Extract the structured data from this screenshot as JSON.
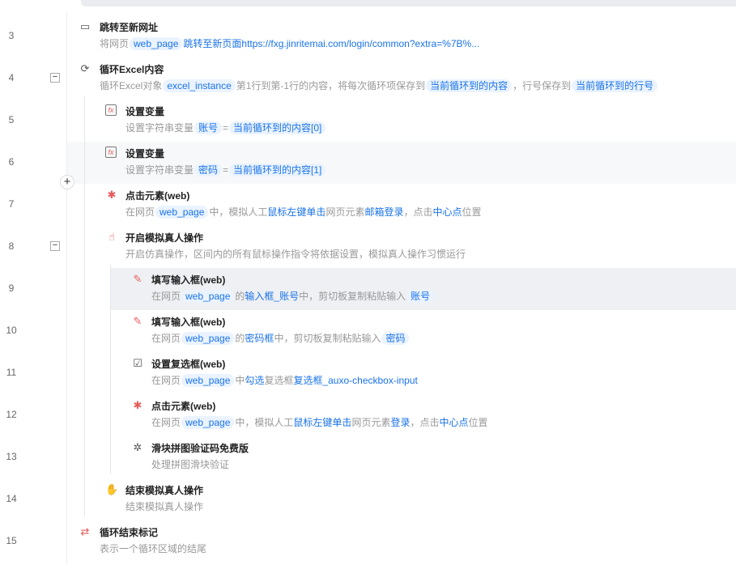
{
  "rows": [
    {
      "num": "3",
      "level": 0,
      "icon": "browser-redirect-icon",
      "glyph": "▭",
      "title": "跳转至新网址",
      "desc": [
        {
          "t": "将网页",
          "k": "g"
        },
        {
          "t": "web_page",
          "k": "chip"
        },
        {
          "t": "跳转至新页面https://fxg.jinritemai.com/login/common?extra=%7B%...",
          "k": "b"
        }
      ]
    },
    {
      "num": "4",
      "level": 0,
      "toggle": "−",
      "icon": "excel-loop-icon",
      "glyph": "⟳",
      "title": "循环Excel内容",
      "desc": [
        {
          "t": "循环Excel对象",
          "k": "g"
        },
        {
          "t": "excel_instance",
          "k": "chip"
        },
        {
          "t": "第1行到第-1行的内容，将每次循环项保存到",
          "k": "g"
        },
        {
          "t": "当前循环到的内容",
          "k": "chip"
        },
        {
          "t": "，行号保存到",
          "k": "g"
        },
        {
          "t": "当前循环到的行号",
          "k": "chip"
        }
      ]
    },
    {
      "num": "5",
      "level": 1,
      "icon": "set-variable-icon",
      "glyph": "fx",
      "title": "设置变量",
      "desc": [
        {
          "t": "设置字符串变量",
          "k": "g"
        },
        {
          "t": "账号",
          "k": "chip"
        },
        {
          "t": "=",
          "k": "g"
        },
        {
          "t": "当前循环到的内容[0]",
          "k": "chip"
        }
      ]
    },
    {
      "num": "6",
      "level": 1,
      "hl": "light",
      "icon": "set-variable-icon",
      "glyph": "fx",
      "title": "设置变量",
      "desc": [
        {
          "t": "设置字符串变量",
          "k": "g"
        },
        {
          "t": "密码",
          "k": "chip"
        },
        {
          "t": "=",
          "k": "g"
        },
        {
          "t": "当前循环到的内容[1]",
          "k": "chip"
        }
      ]
    },
    {
      "num": "7",
      "level": 1,
      "icon": "click-element-icon",
      "glyph": "✱",
      "title": "点击元素(web)",
      "desc": [
        {
          "t": "在网页",
          "k": "g"
        },
        {
          "t": "web_page",
          "k": "chip"
        },
        {
          "t": "中，模拟人工",
          "k": "g"
        },
        {
          "t": "鼠标左键单击",
          "k": "b"
        },
        {
          "t": "网页元素",
          "k": "g"
        },
        {
          "t": "邮箱登录",
          "k": "b"
        },
        {
          "t": "，点击",
          "k": "g"
        },
        {
          "t": "中心点",
          "k": "b"
        },
        {
          "t": "位置",
          "k": "g"
        }
      ]
    },
    {
      "num": "8",
      "level": 1,
      "toggle": "−",
      "icon": "hand-pointer-icon",
      "glyph": "☝",
      "title": "开启模拟真人操作",
      "desc": [
        {
          "t": "开启仿真操作，区间内的所有鼠标操作指令将依据设置，模拟真人操作习惯运行",
          "k": "g"
        }
      ]
    },
    {
      "num": "9",
      "level": 2,
      "hl": "dark",
      "icon": "fill-input-icon",
      "glyph": "✎",
      "title": "填写输入框(web)",
      "desc": [
        {
          "t": "在网页",
          "k": "g"
        },
        {
          "t": "web_page",
          "k": "chip"
        },
        {
          "t": "的",
          "k": "g"
        },
        {
          "t": "输入框_账号",
          "k": "b"
        },
        {
          "t": "中，剪切板复制粘贴输入",
          "k": "g"
        },
        {
          "t": "账号",
          "k": "chip"
        }
      ]
    },
    {
      "num": "10",
      "level": 2,
      "icon": "fill-input-icon",
      "glyph": "✎",
      "title": "填写输入框(web)",
      "desc": [
        {
          "t": "在网页",
          "k": "g"
        },
        {
          "t": "web_page",
          "k": "chip"
        },
        {
          "t": "的",
          "k": "g"
        },
        {
          "t": "密码框",
          "k": "b"
        },
        {
          "t": "中，剪切板复制粘贴输入",
          "k": "g"
        },
        {
          "t": "密码",
          "k": "chip"
        }
      ]
    },
    {
      "num": "11",
      "level": 2,
      "icon": "checkbox-icon",
      "glyph": "☑",
      "title": "设置复选框(web)",
      "desc": [
        {
          "t": "在网页",
          "k": "g"
        },
        {
          "t": "web_page",
          "k": "chip"
        },
        {
          "t": "中",
          "k": "g"
        },
        {
          "t": "勾选",
          "k": "b"
        },
        {
          "t": "复选框",
          "k": "g"
        },
        {
          "t": "复选框_auxo-checkbox-input",
          "k": "b"
        }
      ]
    },
    {
      "num": "12",
      "level": 2,
      "icon": "click-element-icon",
      "glyph": "✱",
      "title": "点击元素(web)",
      "desc": [
        {
          "t": "在网页",
          "k": "g"
        },
        {
          "t": "web_page",
          "k": "chip"
        },
        {
          "t": "中，模拟人工",
          "k": "g"
        },
        {
          "t": "鼠标左键单击",
          "k": "b"
        },
        {
          "t": "网页元素",
          "k": "g"
        },
        {
          "t": "登录",
          "k": "b"
        },
        {
          "t": "，点击",
          "k": "g"
        },
        {
          "t": "中心点",
          "k": "b"
        },
        {
          "t": "位置",
          "k": "g"
        }
      ]
    },
    {
      "num": "13",
      "level": 2,
      "icon": "puzzle-icon",
      "glyph": "✲",
      "title": "滑块拼图验证码免费版",
      "desc": [
        {
          "t": "处理拼图滑块验证",
          "k": "g"
        }
      ]
    },
    {
      "num": "14",
      "level": 1,
      "icon": "hand-icon",
      "glyph": "✋",
      "title": "结束模拟真人操作",
      "desc": [
        {
          "t": "结束模拟真人操作",
          "k": "g"
        }
      ]
    },
    {
      "num": "15",
      "level": 0,
      "icon": "loop-end-icon",
      "glyph": "⇄",
      "title": "循环结束标记",
      "desc": [
        {
          "t": "表示一个循环区域的结尾",
          "k": "g"
        }
      ]
    }
  ],
  "add_button": "+"
}
